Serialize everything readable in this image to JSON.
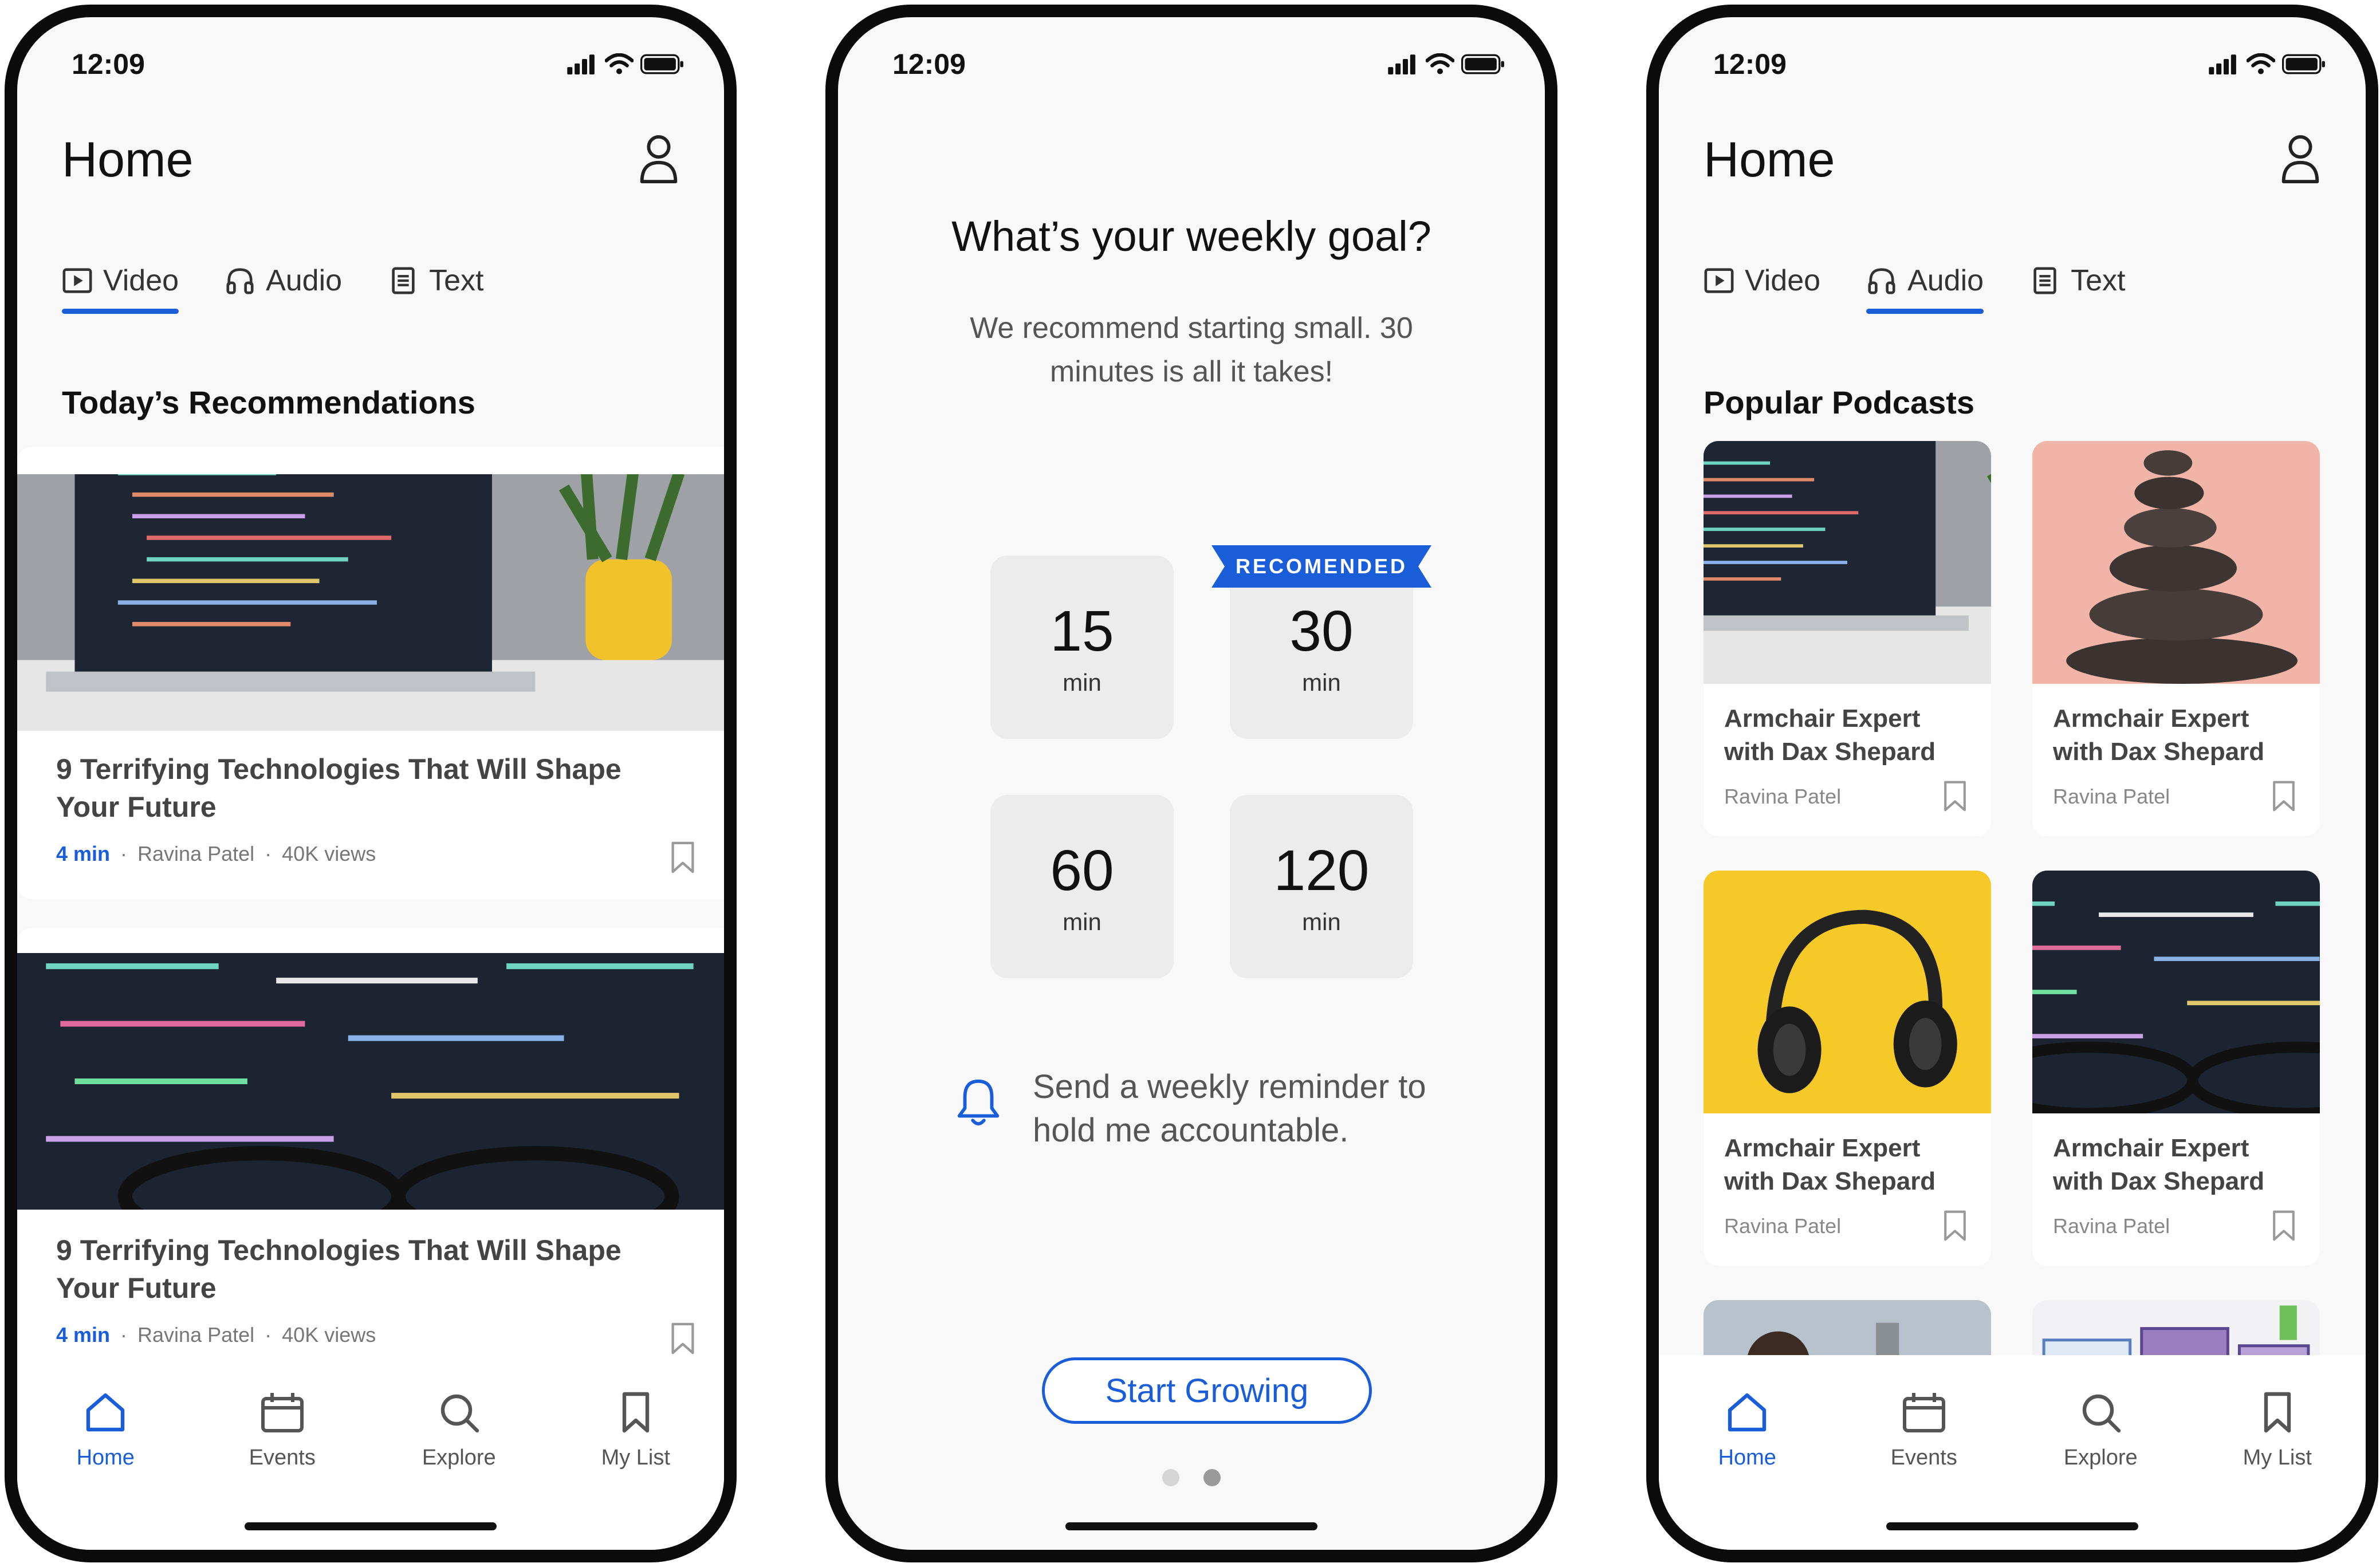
{
  "colors": {
    "accent": "#1a5dd8",
    "text": "#111111",
    "muted": "#777777",
    "screen_bg": "#f8f8f8"
  },
  "status_time": "12:09",
  "phone1": {
    "title": "Home",
    "tabs": [
      {
        "label": "Video",
        "icon": "video-icon",
        "active": true
      },
      {
        "label": "Audio",
        "icon": "headphones-icon",
        "active": false
      },
      {
        "label": "Text",
        "icon": "document-icon",
        "active": false
      }
    ],
    "section_title": "Today’s Recommendations",
    "cards": [
      {
        "title": "9 Terrifying Technologies That Will Shape Your Future",
        "duration": "4 min",
        "author": "Ravina Patel",
        "views": "40K views"
      },
      {
        "title": "9 Terrifying Technologies That Will Shape Your Future",
        "duration": "4 min",
        "author": "Ravina Patel",
        "views": "40K views"
      }
    ]
  },
  "phone2": {
    "title": "What’s your weekly goal?",
    "subtitle": "We recommend starting small. 30 minutes is all it takes!",
    "options": [
      {
        "value": "15",
        "unit": "min"
      },
      {
        "value": "30",
        "unit": "min",
        "badge": "RECOMENDED"
      },
      {
        "value": "60",
        "unit": "min"
      },
      {
        "value": "120",
        "unit": "min"
      }
    ],
    "reminder": "Send a weekly reminder to hold me accountable.",
    "cta": "Start Growing",
    "page_index": {
      "current": 2,
      "total": 2
    }
  },
  "phone3": {
    "title": "Home",
    "tabs": [
      {
        "label": "Video",
        "icon": "video-icon",
        "active": false
      },
      {
        "label": "Audio",
        "icon": "headphones-icon",
        "active": true
      },
      {
        "label": "Text",
        "icon": "document-icon",
        "active": false
      }
    ],
    "section_title": "Popular Podcasts",
    "podcasts": [
      {
        "title": "Armchair Expert with Dax Shepard",
        "author": "Ravina Patel"
      },
      {
        "title": "Armchair Expert with Dax Shepard",
        "author": "Ravina Patel"
      },
      {
        "title": "Armchair Expert with Dax Shepard",
        "author": "Ravina Patel"
      },
      {
        "title": "Armchair Expert with Dax Shepard",
        "author": "Ravina Patel"
      }
    ]
  },
  "nav": {
    "items": [
      {
        "label": "Home",
        "icon": "home-icon",
        "active": true
      },
      {
        "label": "Events",
        "icon": "calendar-icon",
        "active": false
      },
      {
        "label": "Explore",
        "icon": "search-icon",
        "active": false
      },
      {
        "label": "My List",
        "icon": "bookmark-icon",
        "active": false
      }
    ]
  }
}
